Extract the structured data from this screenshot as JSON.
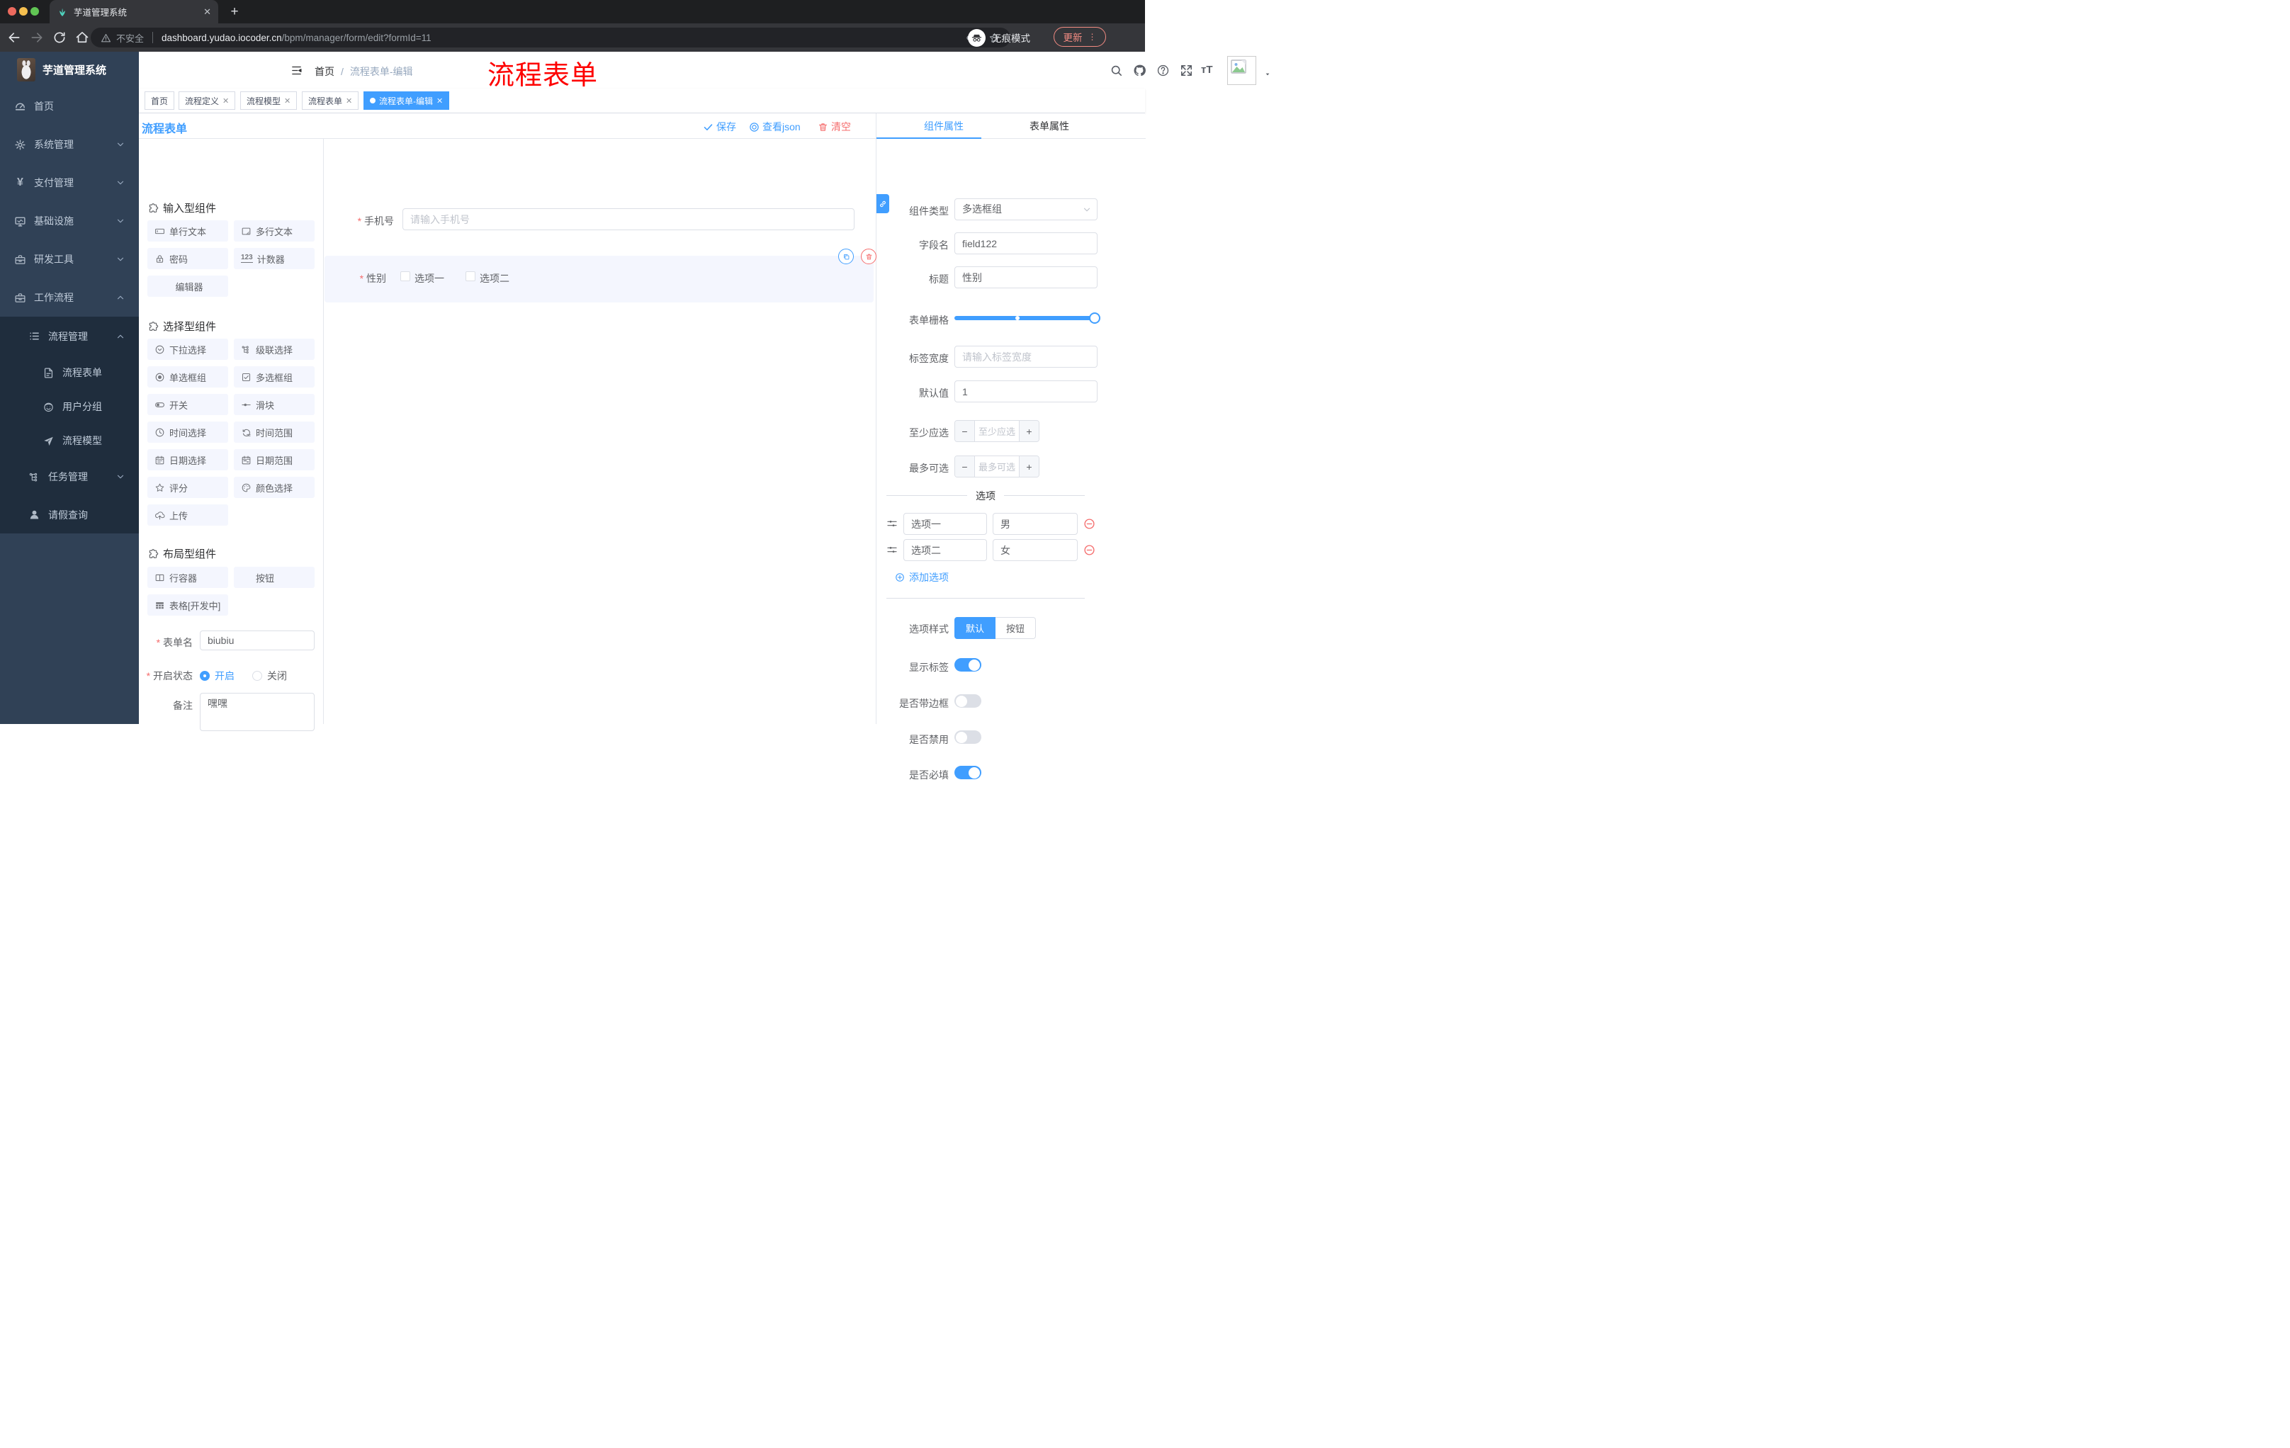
{
  "browser": {
    "tab_title": "芋道管理系统",
    "security": "不安全",
    "url_host": "dashboard.yudao.iocoder.cn",
    "url_path": "/bpm/manager/form/edit?formId=11",
    "incognito": "无痕模式",
    "update": "更新"
  },
  "annotation": {
    "text": "流程表单",
    "color": "#fe0100"
  },
  "sidebar": {
    "logo": "芋道管理系统",
    "items": [
      {
        "label": "首页"
      },
      {
        "label": "系统管理"
      },
      {
        "label": "支付管理"
      },
      {
        "label": "基础设施"
      },
      {
        "label": "研发工具"
      },
      {
        "label": "工作流程"
      },
      {
        "label": "流程管理"
      },
      {
        "label": "流程表单"
      },
      {
        "label": "用户分组"
      },
      {
        "label": "流程模型"
      },
      {
        "label": "任务管理"
      },
      {
        "label": "请假查询"
      }
    ]
  },
  "breadcrumb": {
    "home": "首页",
    "sep": "/",
    "current": "流程表单-编辑"
  },
  "tags": [
    {
      "label": "首页"
    },
    {
      "label": "流程定义"
    },
    {
      "label": "流程模型"
    },
    {
      "label": "流程表单"
    },
    {
      "label": "流程表单-编辑"
    }
  ],
  "content_header": {
    "title": "流程表单",
    "save": "保存",
    "view_json": "查看json",
    "clear": "清空"
  },
  "builder": {
    "section_input": "输入型组件",
    "section_select": "选择型组件",
    "section_layout": "布局型组件",
    "input_items": [
      "单行文本",
      "多行文本",
      "密码",
      "计数器",
      "编辑器"
    ],
    "select_items": [
      "下拉选择",
      "级联选择",
      "单选框组",
      "多选框组",
      "开关",
      "滑块",
      "时间选择",
      "时间范围",
      "日期选择",
      "日期范围",
      "评分",
      "颜色选择",
      "上传"
    ],
    "layout_items": [
      "行容器",
      "按钮",
      "表格[开发中]"
    ],
    "form": {
      "name_label": "表单名",
      "name_value": "biubiu",
      "status_label": "开启状态",
      "status_on": "开启",
      "status_off": "关闭",
      "remark_label": "备注",
      "remark_value": "嘿嘿"
    }
  },
  "canvas": {
    "phone_label": "手机号",
    "phone_placeholder": "请输入手机号",
    "gender_label": "性别",
    "option1": "选项一",
    "option2": "选项二"
  },
  "panel": {
    "tab_component": "组件属性",
    "tab_form": "表单属性",
    "type_label": "组件类型",
    "type_value": "多选框组",
    "field_label": "字段名",
    "field_value": "field122",
    "title_label": "标题",
    "title_value": "性别",
    "grid_label": "表单栅格",
    "width_label": "标签宽度",
    "width_placeholder": "请输入标签宽度",
    "default_label": "默认值",
    "default_value": "1",
    "min_label": "至少应选",
    "min_placeholder": "至少应选",
    "max_label": "最多可选",
    "max_placeholder": "最多可选",
    "options_title": "选项",
    "options": [
      {
        "label": "选项一",
        "value": "男"
      },
      {
        "label": "选项二",
        "value": "女"
      }
    ],
    "add_option": "添加选项",
    "style_label": "选项样式",
    "style_default": "默认",
    "style_button": "按钮",
    "show_label": "显示标签",
    "border_label": "是否带边框",
    "disabled_label": "是否禁用",
    "required_label": "是否必填",
    "accent_color": "#409eff",
    "danger_color": "#f56c6c"
  }
}
